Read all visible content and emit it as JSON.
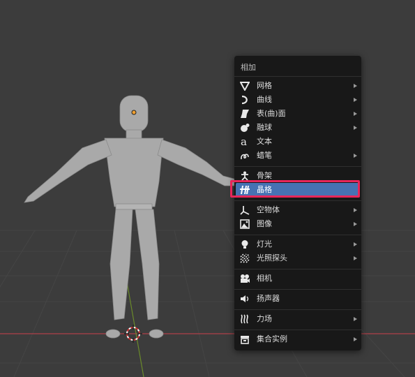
{
  "menu": {
    "title": "相加",
    "items": [
      {
        "label": "网格",
        "icon": "mesh-icon",
        "submenu": true
      },
      {
        "label": "曲线",
        "icon": "curve-icon",
        "submenu": true
      },
      {
        "label": "表(曲)面",
        "icon": "surface-icon",
        "submenu": true
      },
      {
        "label": "融球",
        "icon": "metaball-icon",
        "submenu": true
      },
      {
        "label": "文本",
        "icon": "text-icon",
        "submenu": false
      },
      {
        "label": "蜡笔",
        "icon": "grease-pencil-icon",
        "submenu": true
      },
      {
        "label": "骨架",
        "icon": "armature-icon",
        "submenu": false
      },
      {
        "label": "晶格",
        "icon": "lattice-icon",
        "submenu": false,
        "active": true
      },
      {
        "label": "空物体",
        "icon": "empty-icon",
        "submenu": true
      },
      {
        "label": "图像",
        "icon": "image-icon",
        "submenu": true
      },
      {
        "label": "灯光",
        "icon": "light-icon",
        "submenu": true
      },
      {
        "label": "光照探头",
        "icon": "light-probe-icon",
        "submenu": true
      },
      {
        "label": "相机",
        "icon": "camera-icon",
        "submenu": false
      },
      {
        "label": "扬声器",
        "icon": "speaker-icon",
        "submenu": false
      },
      {
        "label": "力场",
        "icon": "force-field-icon",
        "submenu": true
      },
      {
        "label": "集合实例",
        "icon": "collection-instance-icon",
        "submenu": true
      }
    ]
  },
  "colors": {
    "viewport_bg": "#3c3c3c",
    "menu_bg": "#181818",
    "active_item": "#4772b3",
    "highlight_border": "#e8265a",
    "x_axis": "#b0404a",
    "y_axis": "#6a8a2a",
    "model": "#a9a9a9"
  }
}
